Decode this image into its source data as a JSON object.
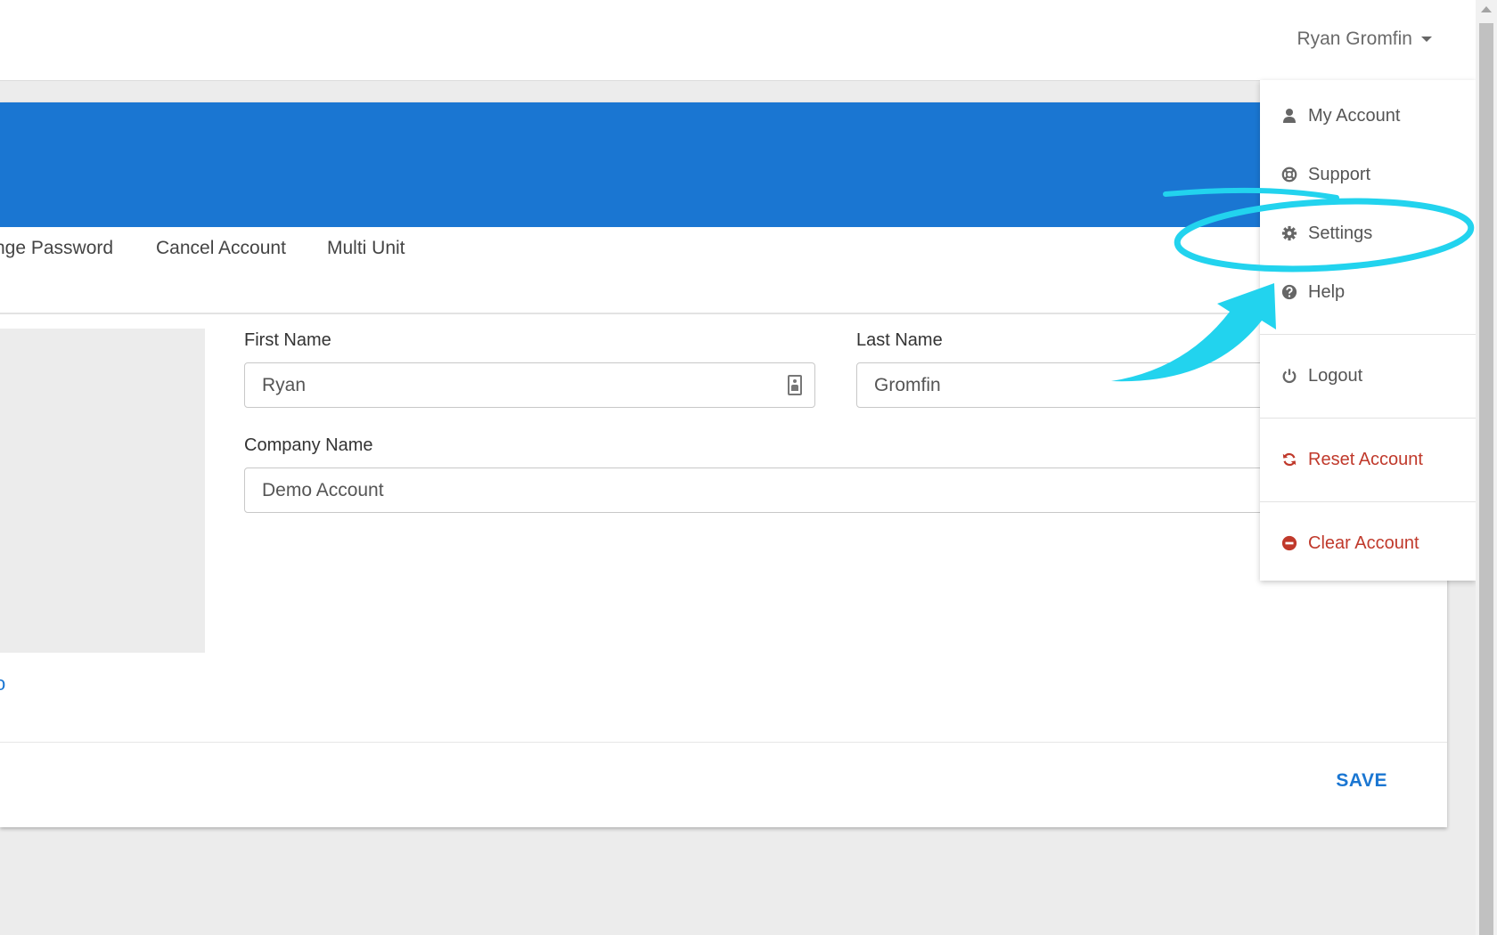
{
  "header": {
    "user_name": "Ryan Gromfin"
  },
  "tabs": [
    {
      "label": "nge Password"
    },
    {
      "label": "Cancel Account"
    },
    {
      "label": "Multi Unit"
    }
  ],
  "profile": {
    "photo_link": "o",
    "first_name_label": "First Name",
    "first_name_value": "Ryan",
    "last_name_label": "Last Name",
    "last_name_value": "Gromfin",
    "company_label": "Company Name",
    "company_value": "Demo Account",
    "save_label": "SAVE"
  },
  "dropdown": {
    "items": [
      {
        "label": "My Account",
        "icon": "user-icon"
      },
      {
        "label": "Support",
        "icon": "lifebuoy-icon"
      },
      {
        "label": "Settings",
        "icon": "gear-icon"
      },
      {
        "label": "Help",
        "icon": "question-icon"
      },
      {
        "label": "Logout",
        "icon": "power-icon"
      },
      {
        "label": "Reset Account",
        "icon": "refresh-icon"
      },
      {
        "label": "Clear Account",
        "icon": "minus-circle-icon"
      }
    ]
  },
  "colors": {
    "primary": "#1a76d2",
    "danger": "#c0392b",
    "annotation": "#22d3ee"
  }
}
